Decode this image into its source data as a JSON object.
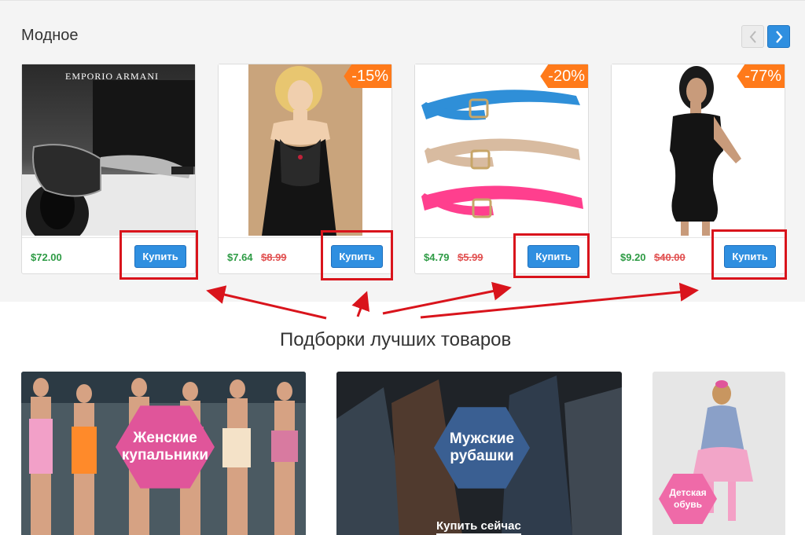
{
  "section": {
    "title": "Модное",
    "nav_prev_icon": "chevron-left-icon",
    "nav_next_icon": "chevron-right-icon"
  },
  "products": [
    {
      "name": "sunglasses",
      "price": "$72.00",
      "old_price": "",
      "discount": "",
      "buy_label": "Купить",
      "brand": "EMPORIO ARMANI"
    },
    {
      "name": "lingerie",
      "price": "$7.64",
      "old_price": "$8.99",
      "discount": "-15%",
      "buy_label": "Купить"
    },
    {
      "name": "belts",
      "price": "$4.79",
      "old_price": "$5.99",
      "discount": "-20%",
      "buy_label": "Купить"
    },
    {
      "name": "dress",
      "price": "$9.20",
      "old_price": "$40.00",
      "discount": "-77%",
      "buy_label": "Купить"
    }
  ],
  "annotation": {
    "caption": "Подборки лучших товаров",
    "color": "#d9141c"
  },
  "banners": [
    {
      "label_line1": "Женские",
      "label_line2": "купальники",
      "color": "#e0559a"
    },
    {
      "label_line1": "Мужские",
      "label_line2": "рубашки",
      "cta": "Купить сейчас",
      "color": "#3a5f92"
    },
    {
      "label_line1": "Детская",
      "label_line2": "обувь",
      "color": "#ef6aa8"
    }
  ],
  "colors": {
    "accent": "#2f8fe0",
    "price_green": "#2e9b45",
    "old_price_red": "#e15050",
    "discount_orange": "#ff7a1a"
  }
}
